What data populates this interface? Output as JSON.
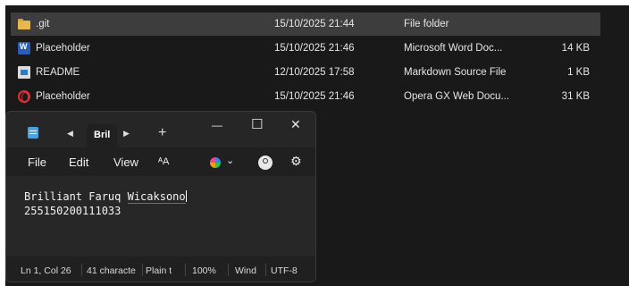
{
  "explorer": {
    "rows": [
      {
        "name": ".git",
        "date": "15/10/2025 21:44",
        "type": "File folder",
        "size": "",
        "icon": "folder-icon",
        "selected": true
      },
      {
        "name": "Placeholder",
        "date": "15/10/2025 21:46",
        "type": "Microsoft Word Doc...",
        "size": "14 KB",
        "icon": "word-doc-icon"
      },
      {
        "name": "README",
        "date": "12/10/2025 17:58",
        "type": "Markdown Source File",
        "size": "1 KB",
        "icon": "markdown-file-icon"
      },
      {
        "name": "Placeholder",
        "date": "15/10/2025 21:46",
        "type": "Opera GX Web Docu...",
        "size": "31 KB",
        "icon": "opera-gx-icon"
      }
    ]
  },
  "notepad": {
    "tab_label": "Bril",
    "tab_prev_glyph": "◀",
    "tab_next_glyph": "▶",
    "new_tab_glyph": "+",
    "window_controls": {
      "minimize": "—",
      "maximize": "☐",
      "close": "✕"
    },
    "menu": {
      "file": "File",
      "edit": "Edit",
      "view": "View"
    },
    "toolbar": {
      "format_glyph": "ᴬA",
      "dropdown_glyph": "⌄",
      "gear_glyph": "⚙"
    },
    "content": {
      "line1_pre": "Brilliant Faruq ",
      "line1_word": "Wicaksono",
      "line2": "255150200111033"
    },
    "status": {
      "position": "Ln 1, Col 26",
      "chars": "41 characte",
      "format": "Plain t",
      "zoom": "100%",
      "line_ending": "Wind",
      "encoding": "UTF-8"
    }
  },
  "colors": {
    "explorer_bg": "#191919",
    "selected_row": "#3d3d3d",
    "notepad_bg": "#202020",
    "accent": "#4aa3e0"
  }
}
